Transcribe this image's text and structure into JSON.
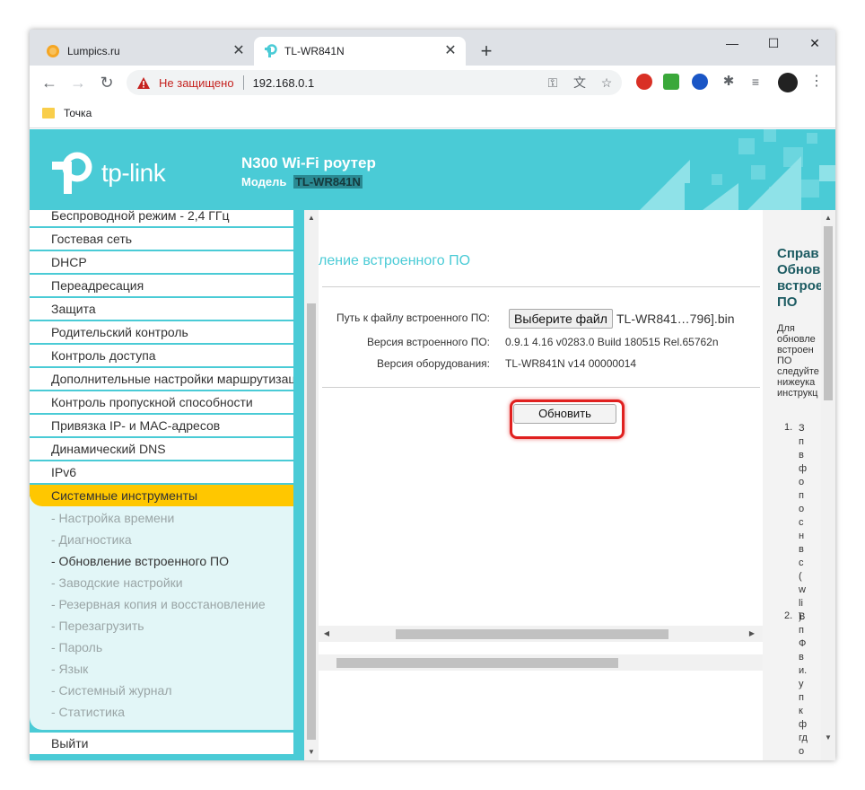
{
  "browser": {
    "tabs": [
      {
        "title": "Lumpics.ru",
        "favicon": "lumpics-orange-circle"
      },
      {
        "title": "TL-WR841N",
        "favicon": "tp-link-logo",
        "active": true
      }
    ],
    "new_tab": "+",
    "window_controls": {
      "minimize": "—",
      "maximize": "☐",
      "close": "✕"
    },
    "nav": {
      "back": "←",
      "forward": "→",
      "reload": "↻"
    },
    "security_text": "Не защищено",
    "url": "192.168.0.1",
    "bookmark": "Точка"
  },
  "router": {
    "brand": "tp-link",
    "title": "N300 Wi-Fi роутер",
    "model_label": "Модель",
    "model_value": "TL-WR841N"
  },
  "sidebar": {
    "items": [
      "Беспроводной режим - 2,4 ГГц",
      "Гостевая сеть",
      "DHCP",
      "Переадресация",
      "Защита",
      "Родительский контроль",
      "Контроль доступа",
      "Дополнительные настройки маршрутизации",
      "Контроль пропускной способности",
      "Привязка IP- и MAC-адресов",
      "Динамический DNS",
      "IPv6",
      "Системные инструменты"
    ],
    "sub_items": [
      "- Настройка времени",
      "- Диагностика",
      "- Обновление встроенного ПО",
      "- Заводские настройки",
      "- Резервная копия и восстановление",
      "- Перезагрузить",
      "- Пароль",
      "- Язык",
      "- Системный журнал",
      "- Статистика"
    ],
    "logout": "Выйти"
  },
  "content": {
    "title": "ление встроенного ПО",
    "fields": {
      "path_label": "Путь к файлу встроенного ПО:",
      "file_button": "Выберите файл",
      "file_name": "TL-WR841…796].bin",
      "fw_label": "Версия встроенного ПО:",
      "fw_value": "0.9.1 4.16 v0283.0 Build 180515 Rel.65762n",
      "hw_label": "Версия оборудования:",
      "hw_value": "TL-WR841N v14 00000014"
    },
    "update_button": "Обновить"
  },
  "help": {
    "title": "Справ\nОбнов\nвстроe\nПО",
    "text": "Для\nобновле\nвстроен\nПО\nследуйте\nнижеука\nинструкц",
    "item1_num": "1.",
    "item1": "З\nп\nв\nф\nо\nп\nо\nс\nн\nв\nс\n(\nw\nli\n).",
    "item2_num": "2.",
    "item2": "В\nп\nФ\nв\nи.\nу\nп\nк\nф\nгд\nо"
  }
}
